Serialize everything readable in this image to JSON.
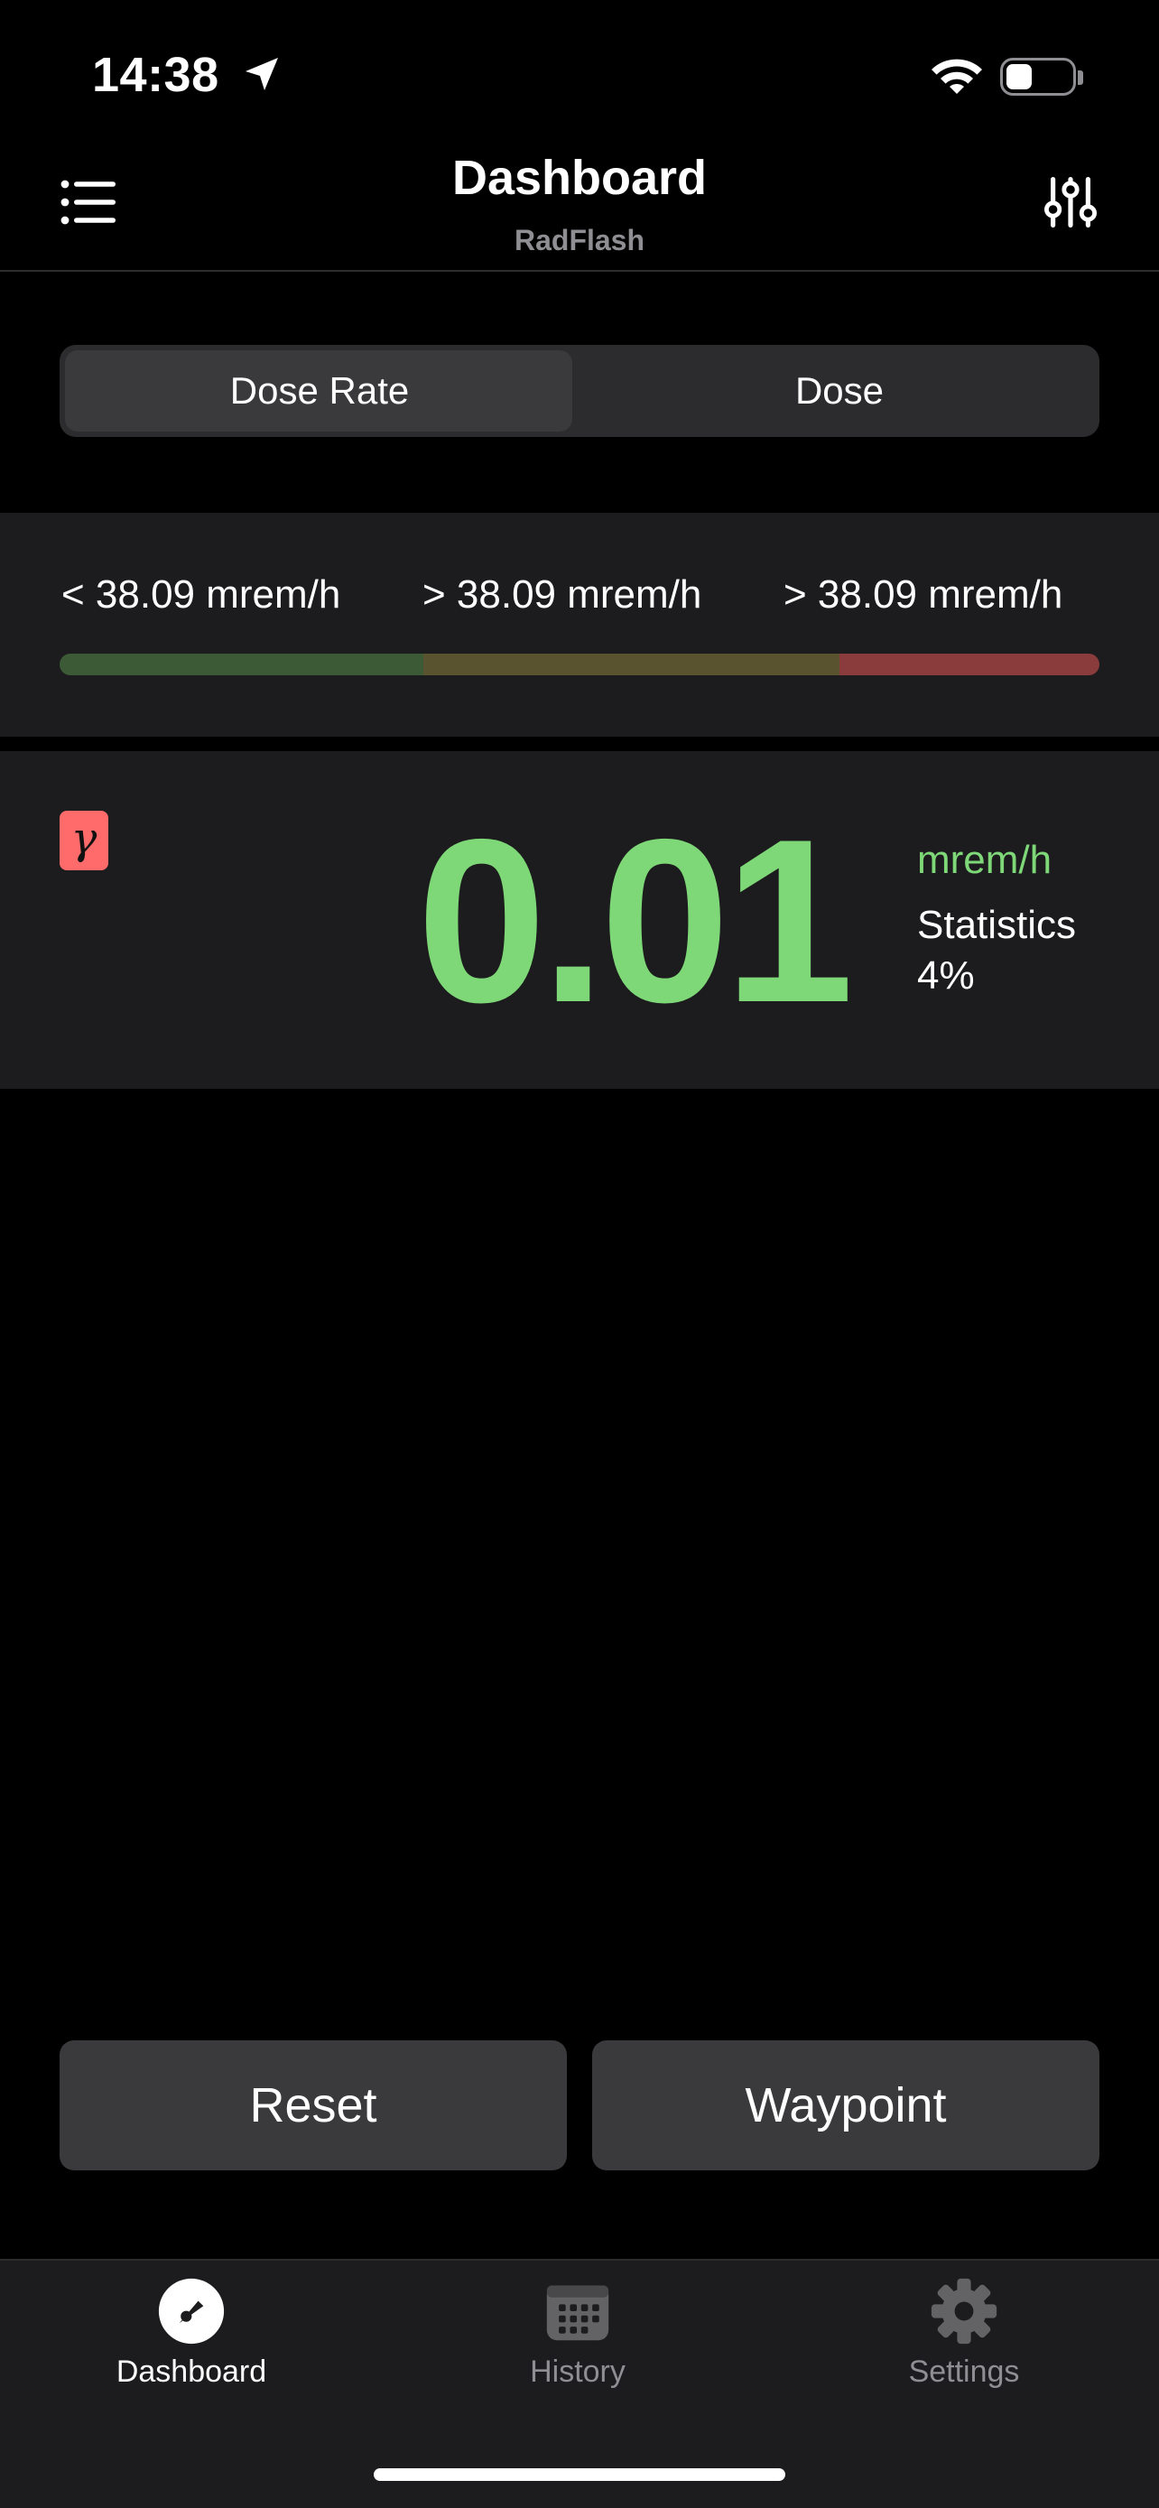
{
  "status_bar": {
    "time": "14:38",
    "icons": [
      "location-arrow-icon",
      "wifi-icon",
      "battery-icon"
    ],
    "battery_level": 0.36
  },
  "nav": {
    "title": "Dashboard",
    "subtitle": "RadFlash",
    "left_icon": "list-icon",
    "right_icon": "sliders-icon"
  },
  "segmented": {
    "options": [
      "Dose Rate",
      "Dose"
    ],
    "selected": "Dose Rate"
  },
  "thresholds": {
    "low": "< 38.09 mrem/h",
    "mid": "> 38.09 mrem/h",
    "high": "> 38.09 mrem/h",
    "bar_colors": [
      "#3c5a36",
      "#5a5330",
      "#8a3b3b"
    ]
  },
  "reading": {
    "badge": "γ",
    "value": "0.01",
    "unit": "mrem/h",
    "stats_label": "Statistics",
    "stats_value": "4%",
    "value_color": "#7ed877",
    "badge_color": "#ff6b6b"
  },
  "actions": {
    "reset": "Reset",
    "waypoint": "Waypoint"
  },
  "tabs": [
    {
      "label": "Dashboard",
      "icon": "gauge-icon",
      "active": true
    },
    {
      "label": "History",
      "icon": "calendar-icon",
      "active": false
    },
    {
      "label": "Settings",
      "icon": "gear-icon",
      "active": false
    }
  ]
}
